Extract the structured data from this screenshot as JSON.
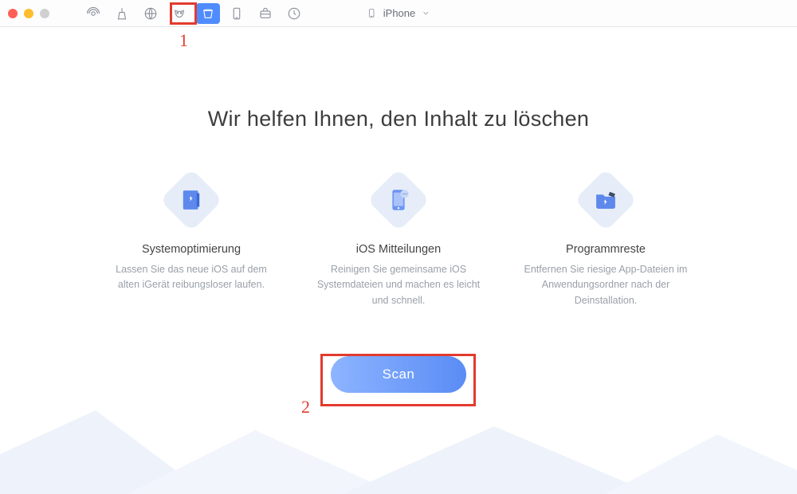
{
  "devicePicker": {
    "label": "iPhone"
  },
  "headline": "Wir helfen Ihnen, den Inhalt zu löschen",
  "features": [
    {
      "title": "Systemoptimierung",
      "desc": "Lassen Sie das neue iOS auf dem alten iGerät reibungsloser laufen."
    },
    {
      "title": "iOS  Mitteilungen",
      "desc": "Reinigen Sie gemeinsame iOS Systemdateien und machen es leicht und schnell."
    },
    {
      "title": "Programmreste",
      "desc": "Entfernen Sie riesige App-Dateien im Anwendungsordner nach der Deinstallation."
    }
  ],
  "scanButton": {
    "label": "Scan"
  },
  "annotations": {
    "one": "1",
    "two": "2"
  }
}
